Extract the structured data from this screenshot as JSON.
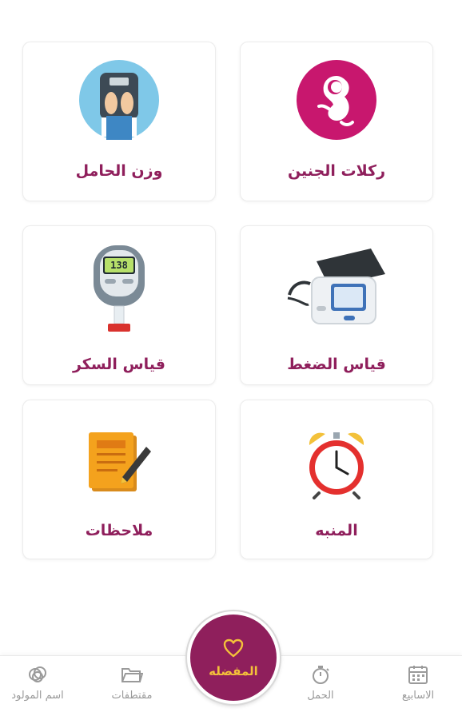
{
  "cards": [
    {
      "label": "ركلات الجنين",
      "icon": "fetus-icon"
    },
    {
      "label": "وزن الحامل",
      "icon": "scale-icon"
    },
    {
      "label": "قياس الضغط",
      "icon": "blood-pressure-monitor-icon"
    },
    {
      "label": "قياس السكر",
      "icon": "glucometer-icon"
    },
    {
      "label": "المنبه",
      "icon": "alarm-clock-icon"
    },
    {
      "label": "ملاحظات",
      "icon": "notepad-icon"
    }
  ],
  "glucometer_reading": "138",
  "fab": {
    "label": "المفضله",
    "icon": "heart-icon"
  },
  "nav": [
    {
      "label": "الاسابيع",
      "icon": "calendar-icon"
    },
    {
      "label": "الحمل",
      "icon": "timer-icon"
    },
    {
      "label": "مقتطفات",
      "icon": "folder-icon"
    },
    {
      "label": "اسم المولود",
      "icon": "baby-rings-icon"
    }
  ],
  "colors": {
    "accent": "#8f1f5c",
    "fab_text": "#f3c13a",
    "nav_gray": "#9a9a9a"
  }
}
